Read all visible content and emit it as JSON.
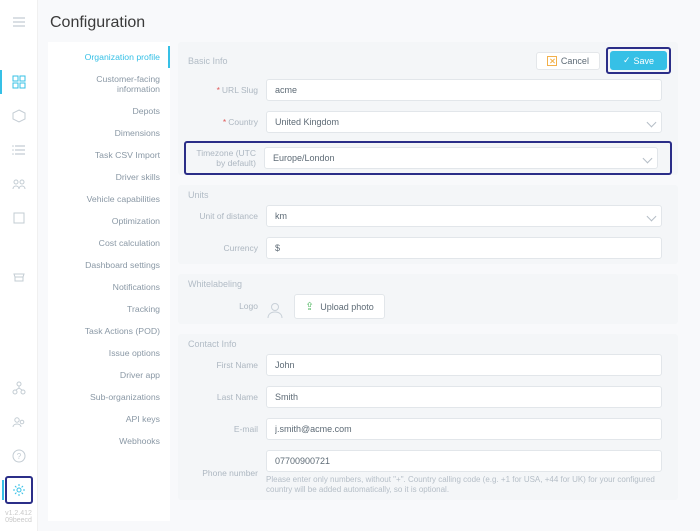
{
  "rail": {
    "version": "v1.2.412",
    "versionSub": "09beecd"
  },
  "page": {
    "title": "Configuration"
  },
  "nav": {
    "items": [
      "Organization profile",
      "Customer-facing information",
      "Depots",
      "Dimensions",
      "Task CSV Import",
      "Driver skills",
      "Vehicle capabilities",
      "Optimization",
      "Cost calculation",
      "Dashboard settings",
      "Notifications",
      "Tracking",
      "Task Actions (POD)",
      "Issue options",
      "Driver app",
      "Sub-organizations",
      "API keys",
      "Webhooks"
    ]
  },
  "buttons": {
    "cancel": "Cancel",
    "save": "Save"
  },
  "sections": {
    "basic": {
      "title": "Basic Info"
    },
    "units": {
      "title": "Units"
    },
    "white": {
      "title": "Whitelabeling"
    },
    "contact": {
      "title": "Contact Info"
    }
  },
  "labels": {
    "url_slug": "URL Slug",
    "country": "Country",
    "timezone": "Timezone (UTC by default)",
    "unit_of_distance": "Unit of distance",
    "currency": "Currency",
    "logo": "Logo",
    "upload": "Upload photo",
    "first_name": "First Name",
    "last_name": "Last Name",
    "email": "E-mail",
    "phone": "Phone number",
    "phone_note": "Please enter only numbers, without \"+\". Country calling code (e.g. +1 for USA, +44 for UK) for your configured country will be added automatically, so it is optional."
  },
  "values": {
    "url_slug": "acme",
    "country": "United Kingdom",
    "timezone": "Europe/London",
    "unit_of_distance": "km",
    "currency": "$",
    "first_name": "John",
    "last_name": "Smith",
    "email": "j.smith@acme.com",
    "phone": "07700900721"
  }
}
